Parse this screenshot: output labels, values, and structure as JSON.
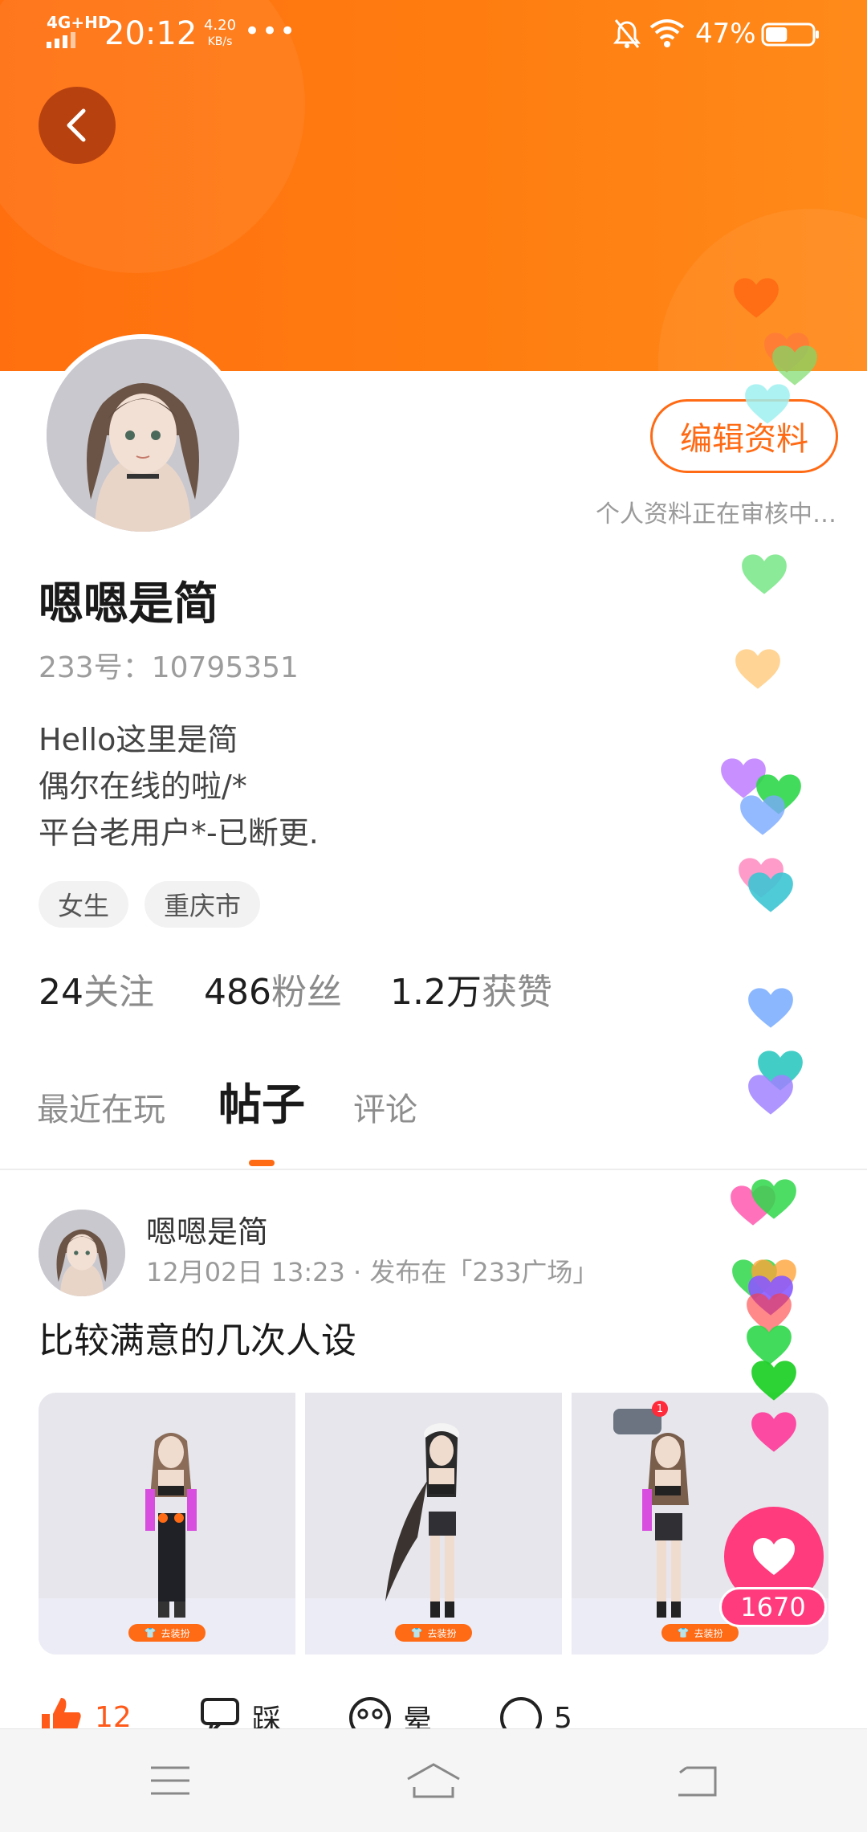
{
  "status_bar": {
    "network": "4G+HD",
    "time": "20:12",
    "speed_value": "4.20",
    "speed_unit": "KB/s",
    "more_dots": "•••",
    "battery_percent": "47%",
    "battery_level": 0.47
  },
  "profile": {
    "edit_button": "编辑资料",
    "review_status": "个人资料正在审核中…",
    "username": "嗯嗯是简",
    "id_text": "233号：10795351",
    "bio_lines": [
      "Hello这里是简",
      "偶尔在线的啦/*",
      "平台老用户*-已断更."
    ],
    "tags": [
      "女生",
      "重庆市"
    ],
    "stats": [
      {
        "value": "24",
        "label": "关注"
      },
      {
        "value": "486",
        "label": "粉丝"
      },
      {
        "value": "1.2万",
        "label": "获赞"
      }
    ]
  },
  "tabs": [
    {
      "label": "最近在玩",
      "active": false
    },
    {
      "label": "帖子",
      "active": true
    },
    {
      "label": "评论",
      "active": false
    }
  ],
  "post": {
    "author": "嗯嗯是简",
    "meta": "12月02日 13:23 · 发布在「233广场」",
    "title": "比较满意的几次人设",
    "image_badge": "去装扮",
    "notification_count": "1",
    "actions": [
      {
        "icon": "thumbs-up-icon",
        "text": "12"
      },
      {
        "icon": "dislike-icon",
        "text": "踩"
      },
      {
        "icon": "dizzy-face-icon",
        "text": "晕"
      },
      {
        "icon": "comment-icon",
        "text": "5"
      }
    ]
  },
  "like_counter": "1670",
  "colors": {
    "accent": "#ff6a14",
    "like_pink": "#ff3a7d",
    "banner": "#ff7a12"
  },
  "nav": [
    "menu-icon",
    "home-icon",
    "back-icon"
  ]
}
